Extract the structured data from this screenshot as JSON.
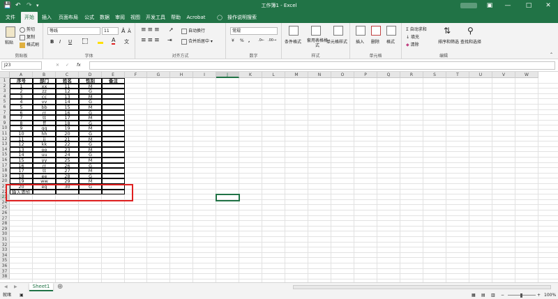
{
  "window": {
    "title": "工作簿1 - Excel",
    "colors": {
      "brand": "#217346",
      "highlight": "#e02020"
    }
  },
  "tabs": [
    "文件",
    "开始",
    "插入",
    "页面布局",
    "公式",
    "数据",
    "审阅",
    "视图",
    "开发工具",
    "帮助",
    "Acrobat"
  ],
  "tell_me": "操作说明搜索",
  "ribbon": {
    "clipboard": {
      "label": "剪贴板",
      "paste": "粘贴",
      "cut": "剪切",
      "copy": "复制",
      "format_painter": "格式刷"
    },
    "font": {
      "label": "字体",
      "name": "等线",
      "size": "11",
      "bold": "B",
      "italic": "I",
      "underline": "U"
    },
    "alignment": {
      "label": "对齐方式",
      "wrap": "自动换行",
      "merge": "合并后居中"
    },
    "number": {
      "label": "数字",
      "format": "常规",
      "percent": "%",
      "comma": ","
    },
    "styles": {
      "label": "样式",
      "conditional": "条件格式",
      "table_format": "套用表格格式",
      "cell_styles": "单元格样式"
    },
    "cells": {
      "label": "单元格",
      "insert": "插入",
      "delete": "删除",
      "format": "格式"
    },
    "editing": {
      "label": "编辑",
      "autosum": "自动求和",
      "fill": "填充",
      "clear": "清除",
      "sort": "排序和筛选",
      "find": "查找和选择"
    }
  },
  "formula_bar": {
    "cell_ref": "J23",
    "fx": "fx",
    "value": ""
  },
  "columns": [
    "A",
    "B",
    "C",
    "D",
    "E",
    "F",
    "G",
    "H",
    "I",
    "J",
    "K",
    "L",
    "M",
    "N",
    "O",
    "P",
    "Q",
    "R",
    "S",
    "T",
    "U",
    "V",
    "W"
  ],
  "rows": [
    "1",
    "2",
    "3",
    "4",
    "5",
    "6",
    "7",
    "8",
    "9",
    "10",
    "11",
    "12",
    "13",
    "14",
    "15",
    "16",
    "17",
    "18",
    "19",
    "20",
    "21",
    "22",
    "23",
    "24",
    "25",
    "26",
    "27",
    "28",
    "29",
    "30",
    "31",
    "32",
    "33",
    "34",
    "35",
    "36",
    "37",
    "38"
  ],
  "table": {
    "headers": [
      "序号",
      "部门",
      "姓名",
      "性别",
      "备注"
    ],
    "data": [
      [
        "1",
        "xx",
        "11",
        "M",
        ""
      ],
      [
        "2",
        "zz",
        "12",
        "G",
        ""
      ],
      [
        "3",
        "cc",
        "13",
        "M",
        ""
      ],
      [
        "4",
        "vv",
        "14",
        "G",
        ""
      ],
      [
        "5",
        "bb",
        "15",
        "M",
        ""
      ],
      [
        "6",
        "rr",
        "16",
        "G",
        ""
      ],
      [
        "7",
        "tt",
        "17",
        "M",
        ""
      ],
      [
        "8",
        "ff",
        "18",
        "G",
        ""
      ],
      [
        "9",
        "gg",
        "19",
        "M",
        ""
      ],
      [
        "10",
        "hh",
        "20",
        "G",
        ""
      ],
      [
        "11",
        "jj",
        "21",
        "M",
        ""
      ],
      [
        "12",
        "kk",
        "22",
        "G",
        ""
      ],
      [
        "13",
        "oo",
        "23",
        "M",
        ""
      ],
      [
        "14",
        "uu",
        "24",
        "G",
        ""
      ],
      [
        "15",
        "yy",
        "25",
        "M",
        ""
      ],
      [
        "16",
        "rr",
        "26",
        "G",
        ""
      ],
      [
        "17",
        "tt",
        "27",
        "M",
        ""
      ],
      [
        "18",
        "ee",
        "28",
        "G",
        ""
      ],
      [
        "19",
        "ww",
        "29",
        "M",
        ""
      ],
      [
        "20",
        "eq",
        "30",
        "G",
        ""
      ]
    ],
    "input_row": [
      "输入添加",
      "",
      "",
      "",
      ""
    ]
  },
  "selected_cell": "J23",
  "sheet_tabs": [
    "Sheet1"
  ],
  "status": {
    "ready": "就绪",
    "zoom": "100%"
  }
}
